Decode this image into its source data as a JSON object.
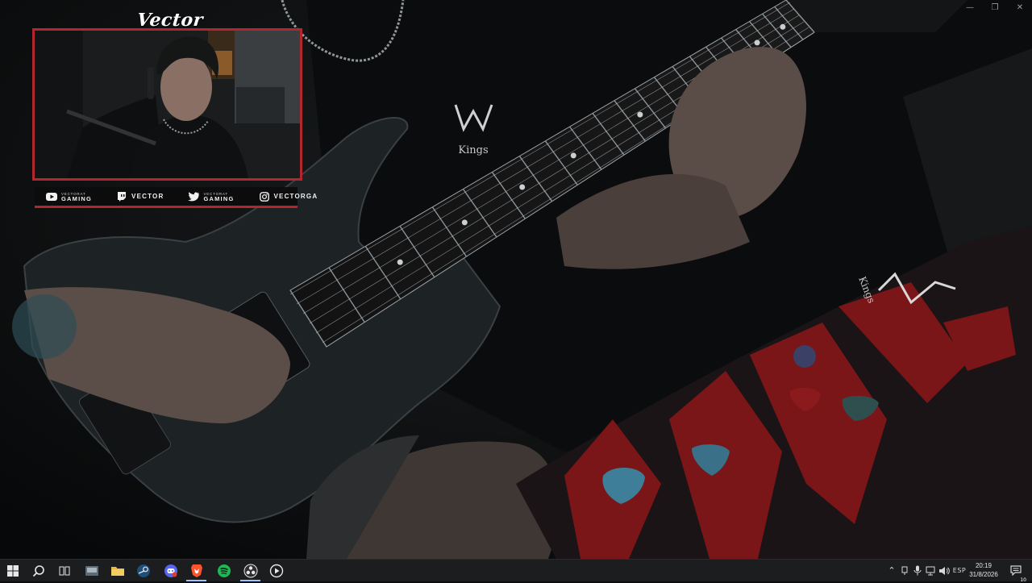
{
  "overlay": {
    "brand": "Vector",
    "socials": [
      {
        "icon": "youtube-icon",
        "line1": "VECTORAT",
        "line2": "GAMING"
      },
      {
        "icon": "twitch-icon",
        "label": "VECTOR"
      },
      {
        "icon": "twitter-icon",
        "line1": "VECTORAT",
        "line2": "GAMING"
      },
      {
        "icon": "instagram-icon",
        "label": "VECTORGA"
      }
    ],
    "accent_color": "#b3262d"
  },
  "scene": {
    "headstock_logo": "Kings",
    "strap_logo": "Kings"
  },
  "taskbar": {
    "apps": [
      "windows-start",
      "search",
      "task-view",
      "file-explorer-app",
      "folder-app",
      "steam-app",
      "discord-app",
      "brave-browser-app",
      "spotify-app",
      "obs-app",
      "media-player-app"
    ],
    "language": "ESP",
    "time": "20:19",
    "date": "31/8/2026",
    "notifications": "10"
  }
}
